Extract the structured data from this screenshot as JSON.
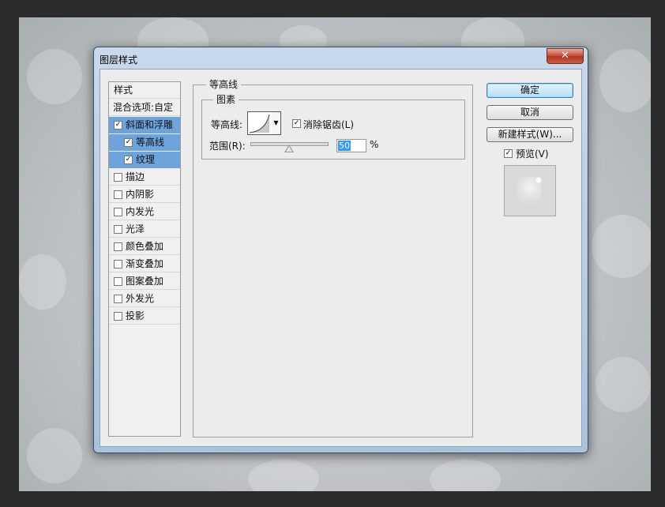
{
  "dialog": {
    "title": "图层样式",
    "close_glyph": "✕"
  },
  "styles_panel": {
    "header": "样式",
    "blend_options": "混合选项:自定",
    "items": [
      {
        "label": "斜面和浮雕",
        "checked": true,
        "selected": true,
        "indent": false
      },
      {
        "label": "等高线",
        "checked": true,
        "selected": true,
        "indent": true
      },
      {
        "label": "纹理",
        "checked": true,
        "selected": true,
        "indent": true
      },
      {
        "label": "描边",
        "checked": false,
        "selected": false,
        "indent": false
      },
      {
        "label": "内阴影",
        "checked": false,
        "selected": false,
        "indent": false
      },
      {
        "label": "内发光",
        "checked": false,
        "selected": false,
        "indent": false
      },
      {
        "label": "光泽",
        "checked": false,
        "selected": false,
        "indent": false
      },
      {
        "label": "颜色叠加",
        "checked": false,
        "selected": false,
        "indent": false
      },
      {
        "label": "渐变叠加",
        "checked": false,
        "selected": false,
        "indent": false
      },
      {
        "label": "图案叠加",
        "checked": false,
        "selected": false,
        "indent": false
      },
      {
        "label": "外发光",
        "checked": false,
        "selected": false,
        "indent": false
      },
      {
        "label": "投影",
        "checked": false,
        "selected": false,
        "indent": false
      }
    ]
  },
  "contour_section": {
    "group_title": "等高线",
    "sub_title": "图素",
    "contour_label": "等高线:",
    "antialias_label": "消除锯齿(L)",
    "antialias_checked": true,
    "range_label": "范围(R):",
    "range_value": "50",
    "range_unit": "%"
  },
  "buttons": {
    "ok": "确定",
    "cancel": "取消",
    "new_style": "新建样式(W)...",
    "preview_label": "预览(V)",
    "preview_checked": true
  },
  "colors": {
    "selection": "#6da4dc",
    "close_button": "#c94d37",
    "default_button": "#b3e0f9"
  }
}
